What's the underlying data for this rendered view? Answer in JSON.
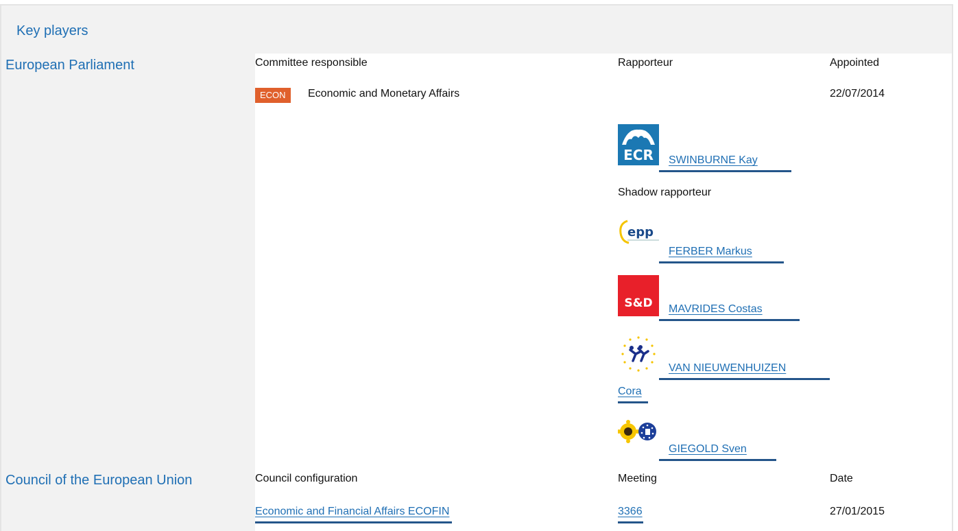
{
  "header": {
    "title": "Key players"
  },
  "parliament": {
    "title": "European Parliament",
    "columns": {
      "committee": "Committee responsible",
      "rapporteur": "Rapporteur",
      "appointed": "Appointed"
    },
    "committee": {
      "badge": "ECON",
      "name": "Economic and Monetary Affairs",
      "appointed": "22/07/2014"
    },
    "rapporteur": {
      "group_logo": "ECR",
      "name": "SWINBURNE Kay"
    },
    "shadow_label": "Shadow rapporteur",
    "shadows": [
      {
        "group_logo": "epp",
        "name": "FERBER Markus"
      },
      {
        "group_logo": "S&D",
        "name": "MAVRIDES Costas"
      },
      {
        "group_logo": "ALDE",
        "name_line1": "VAN NIEUWENHUIZEN",
        "name_line2": "Cora"
      },
      {
        "group_logo": "Greens/EFA",
        "name": "GIEGOLD Sven"
      }
    ]
  },
  "council": {
    "title": "Council of the European Union",
    "columns": {
      "configuration": "Council configuration",
      "meeting": "Meeting",
      "date": "Date"
    },
    "row": {
      "configuration": "Economic and Financial Affairs ECOFIN",
      "meeting": "3366",
      "date": "27/01/2015"
    }
  },
  "colors": {
    "link": "#1f6fb4",
    "badge": "#e0602c",
    "panel_bg": "#f2f2f2"
  }
}
